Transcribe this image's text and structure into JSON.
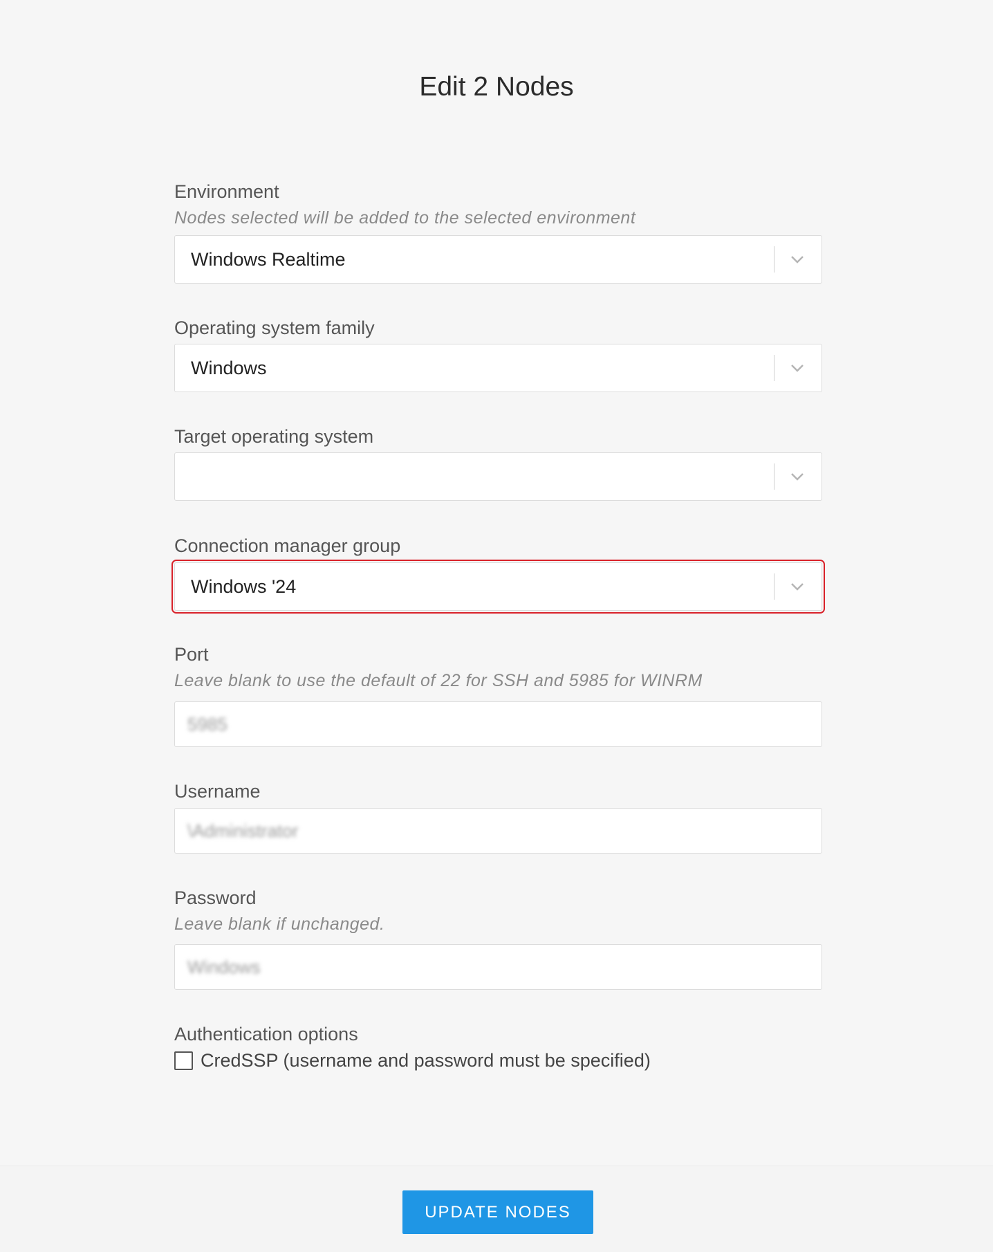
{
  "dialog": {
    "title": "Edit 2 Nodes"
  },
  "fields": {
    "environment": {
      "label": "Environment",
      "help": "Nodes selected will be added to the selected environment",
      "value": "Windows Realtime"
    },
    "os_family": {
      "label": "Operating system family",
      "value": "Windows"
    },
    "target_os": {
      "label": "Target operating system",
      "value": ""
    },
    "connection_manager_group": {
      "label": "Connection manager group",
      "value": "Windows '24"
    },
    "port": {
      "label": "Port",
      "help": "Leave blank to use the default of 22 for SSH and 5985 for WINRM",
      "value": "5985"
    },
    "username": {
      "label": "Username",
      "value": "\\Administrator"
    },
    "password": {
      "label": "Password",
      "help": "Leave blank if unchanged.",
      "value": "Windows"
    },
    "auth_options": {
      "label": "Authentication options",
      "credssp_label": "CredSSP (username and password must be specified)",
      "credssp_checked": false
    }
  },
  "footer": {
    "update_label": "UPDATE NODES"
  },
  "icons": {
    "dropdown": "chevron-down-icon"
  },
  "colors": {
    "accent": "#1f96e5",
    "highlight": "#d9222a",
    "background": "#f6f6f6"
  }
}
